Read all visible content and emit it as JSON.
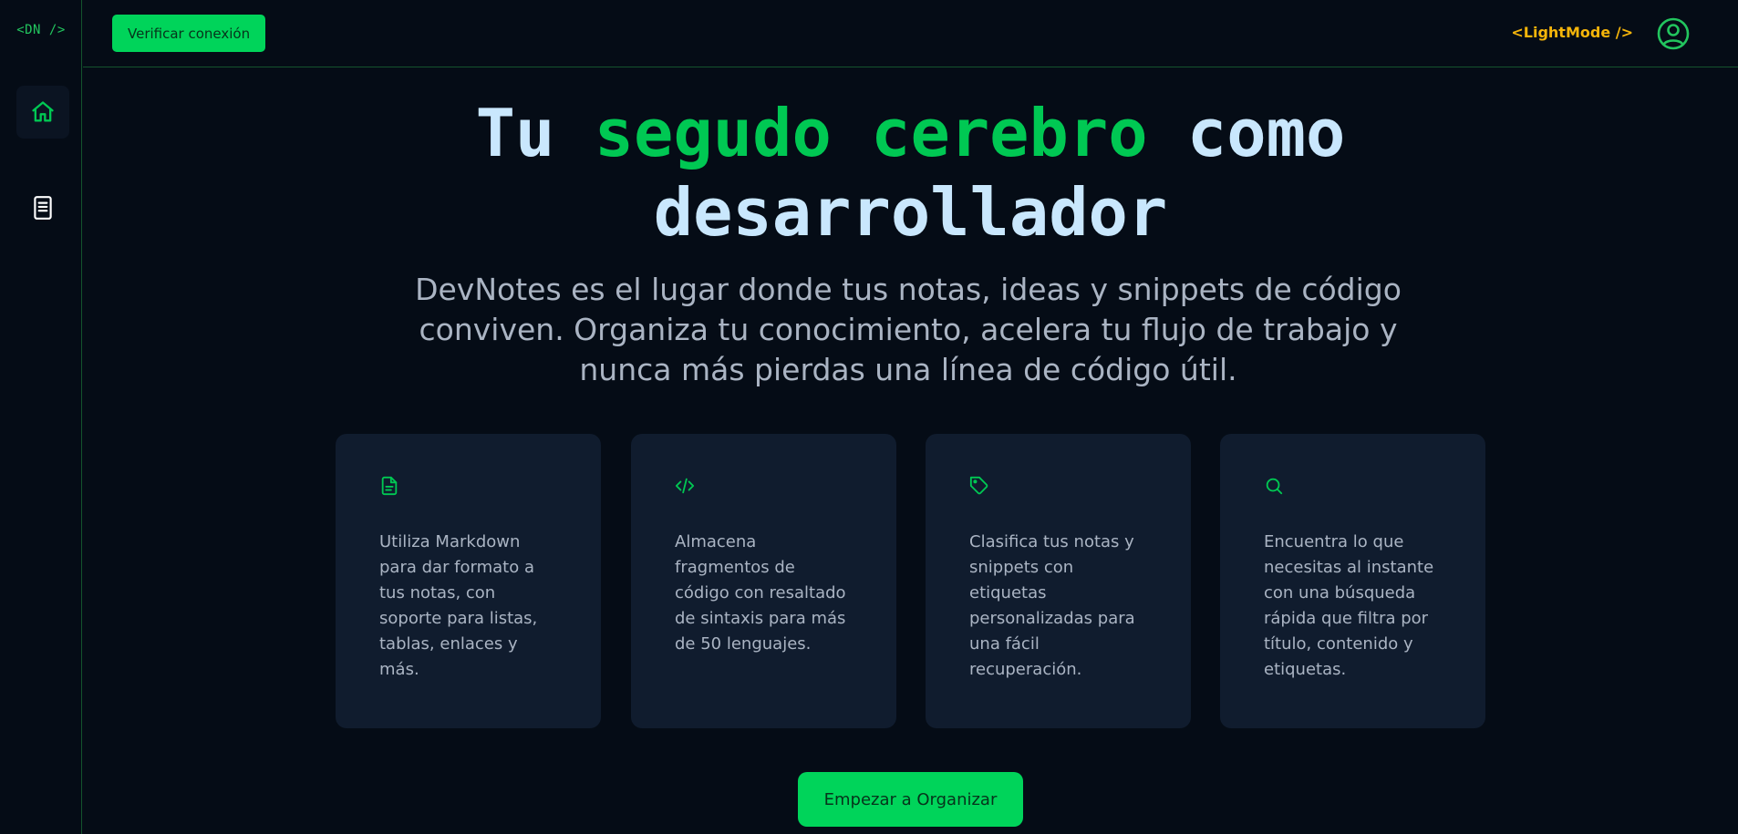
{
  "sidebar": {
    "logo": "<DN />",
    "items": [
      {
        "name": "home",
        "icon": "home-icon",
        "active": true
      },
      {
        "name": "notes",
        "icon": "document-icon",
        "active": false
      }
    ]
  },
  "topbar": {
    "verify_label": "Verificar conexión",
    "lightmode_label": "<LightMode />",
    "profile_icon": "user-circle-icon"
  },
  "hero": {
    "title_part1": "Tu ",
    "title_accent": "segudo cerebro",
    "title_part2": " como",
    "title_line2": "desarrollador",
    "subtitle": "DevNotes es el lugar donde tus notas, ideas y snippets de código conviven. Organiza tu conocimiento, acelera tu flujo de trabajo y nunca más pierdas una línea de código útil."
  },
  "features": [
    {
      "icon": "file-text-icon",
      "text": "Utiliza Markdown para dar formato a tus notas, con soporte para listas, tablas, enlaces y más."
    },
    {
      "icon": "code-icon",
      "text": "Almacena fragmentos de código con resaltado de sintaxis para más de 50 lenguajes."
    },
    {
      "icon": "tag-icon",
      "text": "Clasifica tus notas y snippets con etiquetas personalizadas para una fácil recuperación."
    },
    {
      "icon": "search-icon",
      "text": "Encuentra lo que necesitas al instante con una búsqueda rápida que filtra por título, contenido y etiquetas."
    }
  ],
  "cta": {
    "label": "Empezar a Organizar"
  },
  "colors": {
    "background": "#050c16",
    "accent": "#00d45a",
    "card": "#101c2e",
    "title": "#c9e7fd",
    "warning": "#f5b50a"
  }
}
